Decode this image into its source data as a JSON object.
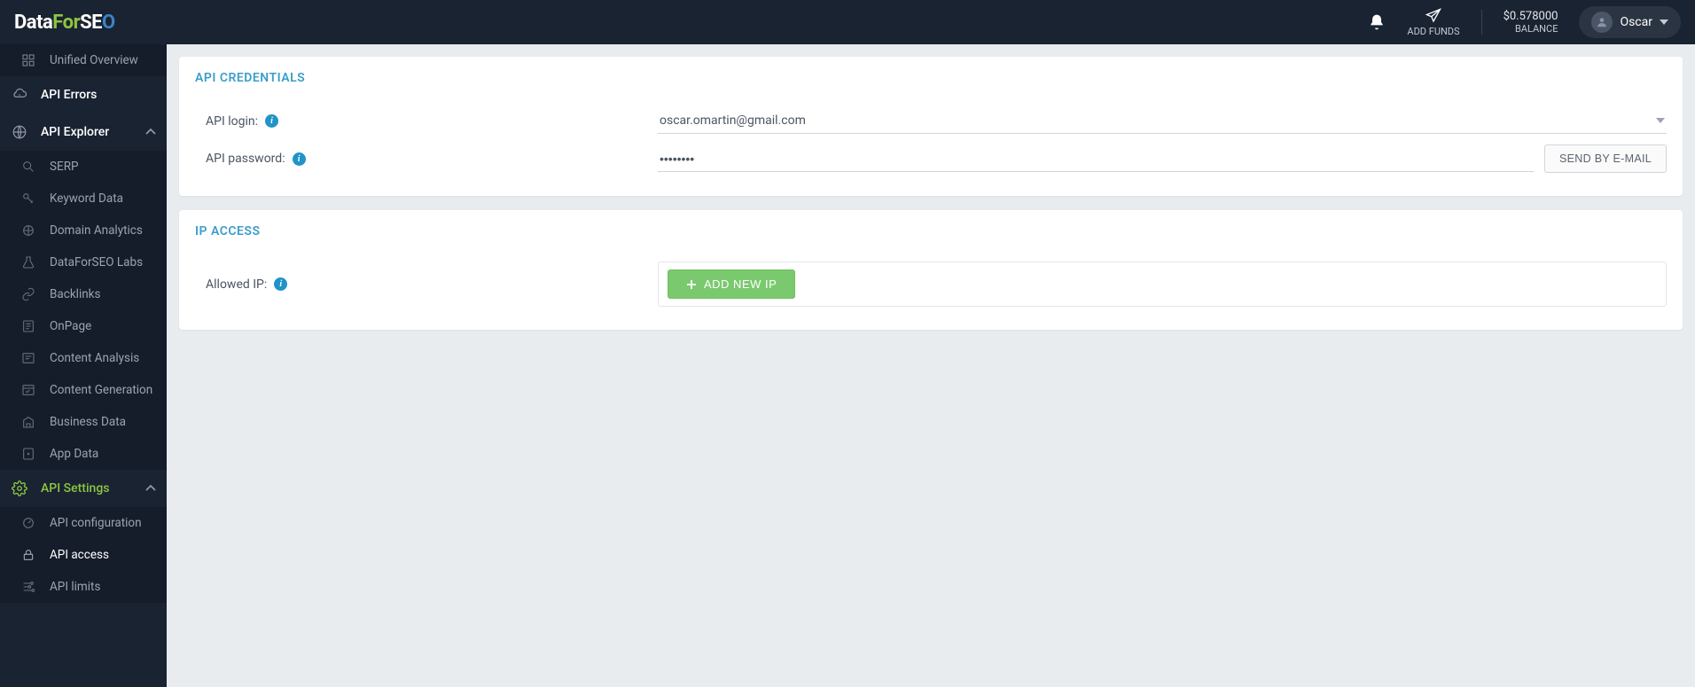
{
  "brand": {
    "p1": "Data",
    "p2": "For",
    "p3": "SE",
    "p4": "O"
  },
  "topbar": {
    "add_funds": "ADD FUNDS",
    "balance_amount": "$0.578000",
    "balance_label": "BALANCE",
    "user_name": "Oscar"
  },
  "sidebar": {
    "unified_overview": "Unified Overview",
    "api_errors": "API Errors",
    "api_explorer": "API Explorer",
    "explorer_items": [
      "SERP",
      "Keyword Data",
      "Domain Analytics",
      "DataForSEO Labs",
      "Backlinks",
      "OnPage",
      "Content Analysis",
      "Content Generation",
      "Business Data",
      "App Data"
    ],
    "api_settings": "API Settings",
    "settings_items": [
      "API configuration",
      "API access",
      "API limits"
    ]
  },
  "credentials": {
    "title": "API CREDENTIALS",
    "login_label": "API login:",
    "login_value": "oscar.omartin@gmail.com",
    "password_label": "API password:",
    "password_value": "••••••••",
    "send_email_btn": "SEND BY E-MAIL"
  },
  "ipaccess": {
    "title": "IP ACCESS",
    "allowed_label": "Allowed IP:",
    "add_btn": "ADD NEW IP"
  }
}
